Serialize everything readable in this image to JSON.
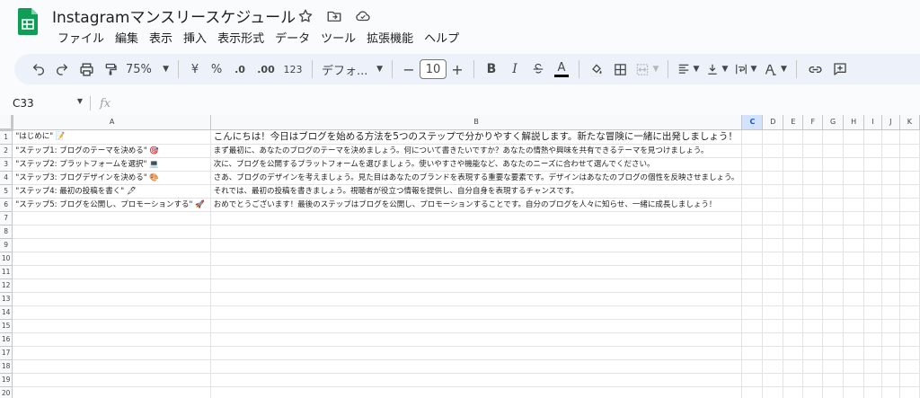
{
  "app": {
    "title": "Instagramマンスリースケジュール",
    "menu": [
      "ファイル",
      "編集",
      "表示",
      "挿入",
      "表示形式",
      "データ",
      "ツール",
      "拡張機能",
      "ヘルプ"
    ]
  },
  "toolbar": {
    "zoom": "75%",
    "currency": "¥",
    "percent": "%",
    "dec_decrease": ".0",
    "dec_increase": ".00",
    "number_format": "123",
    "font": "デフォ...",
    "font_size": "10",
    "minus": "−",
    "plus": "+",
    "bold": "B",
    "italic": "I",
    "text_color": "A",
    "text_color_hex": "#000000"
  },
  "formula_bar": {
    "cell_ref": "C33",
    "fx": "fx",
    "content": ""
  },
  "sheet": {
    "columns": [
      "A",
      "B",
      "C",
      "D",
      "E",
      "F",
      "G",
      "H",
      "I",
      "J",
      "K"
    ],
    "selected_column": "C",
    "rows": [
      {
        "n": "1",
        "a": "\"はじめに\" 📝",
        "b": "こんにちは！今日はブログを始める方法を5つのステップで分かりやすく解説します。新たな冒険に一緒に出発しましょう！"
      },
      {
        "n": "2",
        "a": "\"ステップ1: ブログのテーマを決める\" 🎯",
        "b": "まず最初に、あなたのブログのテーマを決めましょう。何について書きたいですか？あなたの情熱や興味を共有できるテーマを見つけましょう。"
      },
      {
        "n": "3",
        "a": "\"ステップ2: プラットフォームを選択\" 💻",
        "b": "次に、ブログを公開するプラットフォームを選びましょう。使いやすさや機能など、あなたのニーズに合わせて選んでください。"
      },
      {
        "n": "4",
        "a": "\"ステップ3: ブログデザインを決める\" 🎨",
        "b": "さあ、ブログのデザインを考えましょう。見た目はあなたのブランドを表現する重要な要素です。デザインはあなたのブログの個性を反映させましょう。"
      },
      {
        "n": "5",
        "a": "\"ステップ4: 最初の投稿を書く\" 🖋",
        "b": "それでは、最初の投稿を書きましょう。視聴者が役立つ情報を提供し、自分自身を表現するチャンスです。"
      },
      {
        "n": "6",
        "a": " \"ステップ5: ブログを公開し、プロモーションする\" 🚀",
        "b": "おめでとうございます！最後のステップはブログを公開し、プロモーションすることです。自分のブログを人々に知らせ、一緒に成長しましょう！"
      },
      {
        "n": "7",
        "a": "",
        "b": ""
      },
      {
        "n": "8",
        "a": "",
        "b": ""
      },
      {
        "n": "9",
        "a": "",
        "b": ""
      },
      {
        "n": "10",
        "a": "",
        "b": ""
      },
      {
        "n": "11",
        "a": "",
        "b": ""
      },
      {
        "n": "12",
        "a": "",
        "b": ""
      },
      {
        "n": "13",
        "a": "",
        "b": ""
      },
      {
        "n": "14",
        "a": "",
        "b": ""
      },
      {
        "n": "15",
        "a": "",
        "b": ""
      },
      {
        "n": "16",
        "a": "",
        "b": ""
      },
      {
        "n": "17",
        "a": "",
        "b": ""
      },
      {
        "n": "18",
        "a": "",
        "b": ""
      },
      {
        "n": "19",
        "a": "",
        "b": ""
      },
      {
        "n": "20",
        "a": "",
        "b": ""
      }
    ]
  }
}
